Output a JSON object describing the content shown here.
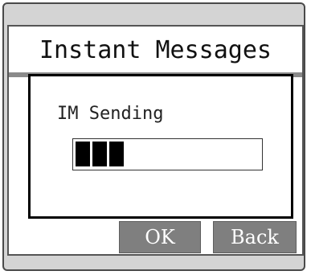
{
  "screen": {
    "title": "Instant Messages"
  },
  "dialog": {
    "message": "IM Sending",
    "progress": {
      "filled_segments": 3,
      "total_segments": 12
    }
  },
  "softkeys": {
    "ok_label": "OK",
    "back_label": "Back"
  }
}
